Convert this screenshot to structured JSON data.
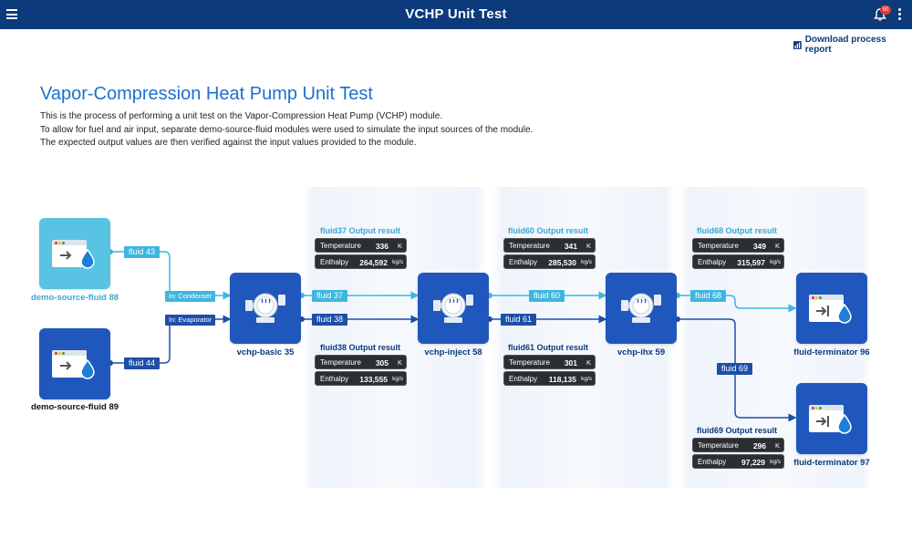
{
  "header": {
    "title": "VCHP Unit Test",
    "notification_count": "50",
    "menu_icon": "hamburger-menu-icon",
    "bell_icon": "bell-icon",
    "more_icon": "more-vertical-icon"
  },
  "download_link": {
    "label": "Download process report",
    "icon": "report-chart-icon"
  },
  "page": {
    "title": "Vapor-Compression Heat Pump Unit Test",
    "description": [
      "This is the process of performing a unit test on the Vapor-Compression Heat Pump (VCHP) module.",
      "To allow for fuel and air input, separate demo-source-fluid modules were used to simulate the input sources of the module.",
      "The expected output values are then verified against the input values provided to the module."
    ]
  },
  "nodes": {
    "source88": "demo-source-fluid 88",
    "source89": "demo-source-fluid 89",
    "vchp_basic": "vchp-basic 35",
    "vchp_inject": "vchp-inject 58",
    "vchp_ihx": "vchp-ihx 59",
    "term96": "fluid-terminator 96",
    "term97": "fluid-terminator 97"
  },
  "ports": {
    "condenser": "In: Condenser",
    "evaporator": "In: Evaporator"
  },
  "fluids": {
    "f43": "fluid 43",
    "f44": "fluid 44",
    "f37": "fluid 37",
    "f38": "fluid 38",
    "f60": "fluid 60",
    "f61": "fluid 61",
    "f68": "fluid 68",
    "f69": "fluid 69"
  },
  "results": {
    "r37": {
      "title": "fluid37  Output result",
      "temp_label": "Temperature",
      "temp": "336",
      "temp_unit": "K",
      "enth_label": "Enthalpy",
      "enth": "264,592",
      "enth_unit": "kg/s"
    },
    "r38": {
      "title": "fluid38  Output result",
      "temp_label": "Temperature",
      "temp": "305",
      "temp_unit": "K",
      "enth_label": "Enthalpy",
      "enth": "133,555",
      "enth_unit": "kg/s"
    },
    "r60": {
      "title": "fluid60  Output result",
      "temp_label": "Temperature",
      "temp": "341",
      "temp_unit": "K",
      "enth_label": "Enthalpy",
      "enth": "285,530",
      "enth_unit": "kg/s"
    },
    "r61": {
      "title": "fluid61  Output result",
      "temp_label": "Temperature",
      "temp": "301",
      "temp_unit": "K",
      "enth_label": "Enthalpy",
      "enth": "118,135",
      "enth_unit": "kg/s"
    },
    "r68": {
      "title": "fluid68  Output result",
      "temp_label": "Temperature",
      "temp": "349",
      "temp_unit": "K",
      "enth_label": "Enthalpy",
      "enth": "315,597",
      "enth_unit": "kg/s"
    },
    "r69": {
      "title": "fluid69  Output result",
      "temp_label": "Temperature",
      "temp": "296",
      "temp_unit": "K",
      "enth_label": "Enthalpy",
      "enth": "97,229",
      "enth_unit": "kg/s"
    }
  },
  "colors": {
    "header": "#0c3a7a",
    "light_flow": "#3fb6df",
    "dark_flow": "#1e4ea8",
    "node_dark": "#2057bd",
    "node_light": "#58c3e3",
    "title": "#1d6fd0"
  }
}
